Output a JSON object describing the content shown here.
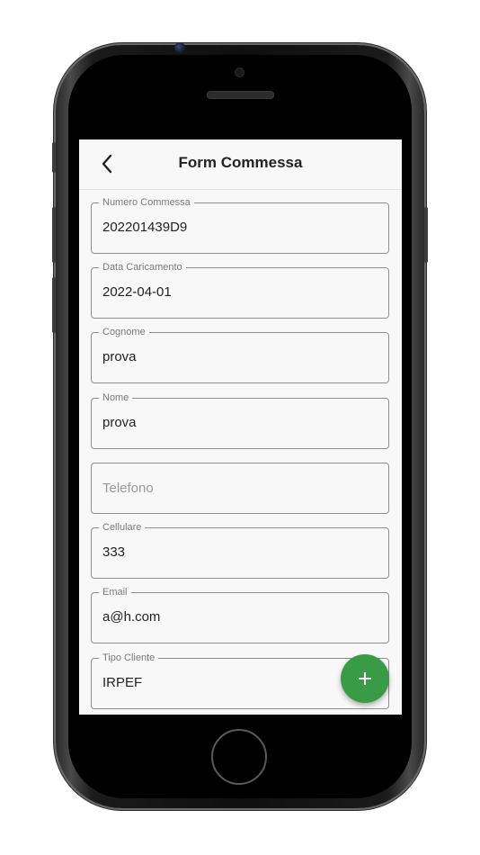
{
  "app_bar": {
    "title": "Form Commessa",
    "back_icon": "chevron-left-icon"
  },
  "fields": [
    {
      "label": "Numero Commessa",
      "value": "202201439D9"
    },
    {
      "label": "Data Caricamento",
      "value": "2022-04-01"
    },
    {
      "label": "Cognome",
      "value": "prova"
    },
    {
      "label": "Nome",
      "value": "prova"
    },
    {
      "label": "",
      "value": "",
      "placeholder": "Telefono"
    },
    {
      "label": "Cellulare",
      "value": "333"
    },
    {
      "label": "Email",
      "value": "a@h.com"
    },
    {
      "label": "Tipo Cliente",
      "value": "IRPEF"
    }
  ],
  "fab": {
    "icon": "plus-icon",
    "color": "#3a9b47"
  }
}
